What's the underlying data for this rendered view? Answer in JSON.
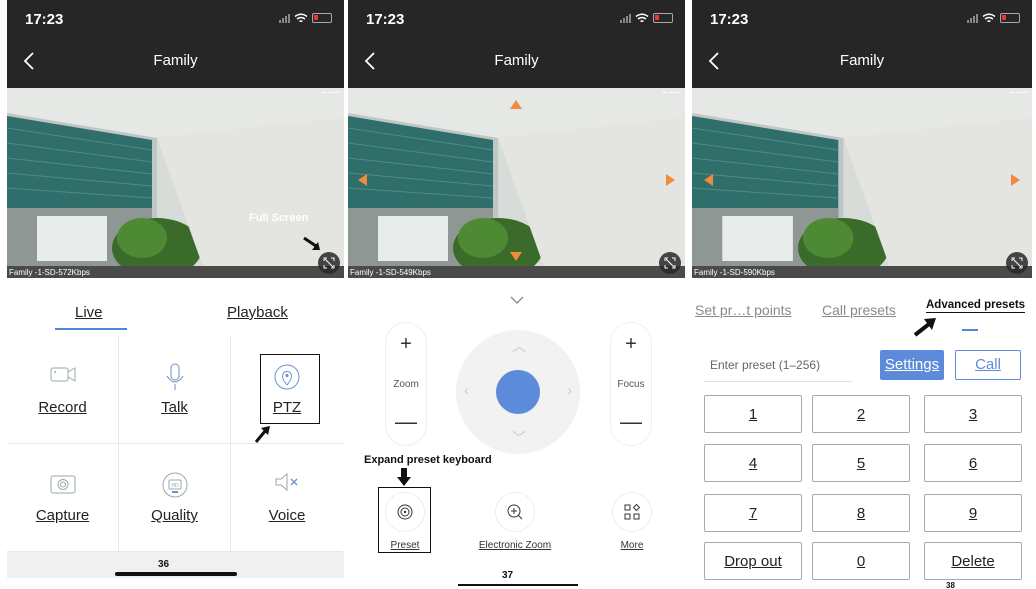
{
  "panels": [
    {
      "time": "17:23",
      "title": "Family",
      "stream_label": "Family -1-SD-572Kbps",
      "annotation_fullscreen": "Full Screen",
      "tabs": {
        "live": "Live",
        "playback": "Playback"
      },
      "controls": [
        {
          "label": "Record",
          "icon": "video-camera-icon"
        },
        {
          "label": "Talk",
          "icon": "microphone-icon"
        },
        {
          "label": "PTZ",
          "icon": "location-pin-icon"
        },
        {
          "label": "Capture",
          "icon": "camera-icon"
        },
        {
          "label": "Quality",
          "icon": "hd-monitor-icon"
        },
        {
          "label": "Voice",
          "icon": "speaker-mute-icon"
        }
      ],
      "page_number": "36"
    },
    {
      "time": "17:23",
      "title": "Family",
      "stream_label": "Family -1-SD-549Kbps",
      "zoom": {
        "plus": "+",
        "label": "Zoom",
        "minus": "—"
      },
      "focus": {
        "plus": "+",
        "label": "Focus",
        "minus": "—"
      },
      "annotation_preset": "Expand preset keyboard",
      "tools": [
        {
          "label": "Preset",
          "icon": "target-icon"
        },
        {
          "label": "Electronic Zoom",
          "icon": "zoom-in-icon"
        },
        {
          "label": "More",
          "icon": "grid-more-icon"
        }
      ],
      "page_number": "37"
    },
    {
      "time": "17:23",
      "title": "Family",
      "stream_label": "Family -1-SD-590Kbps",
      "tabs": {
        "set": "Set pr…t points",
        "call": "Call presets",
        "advanced": "Advanced presets"
      },
      "input_placeholder": "Enter preset (1–256)",
      "settings_button": "Settings",
      "call_button": "Call",
      "keys": [
        "1",
        "2",
        "3",
        "4",
        "5",
        "6",
        "7",
        "8",
        "9",
        "Drop out",
        "0",
        "Delete"
      ],
      "page_number": "38"
    }
  ],
  "colors": {
    "accent": "#5b8bd9",
    "dark": "#262626",
    "orange": "#f08a3c"
  }
}
